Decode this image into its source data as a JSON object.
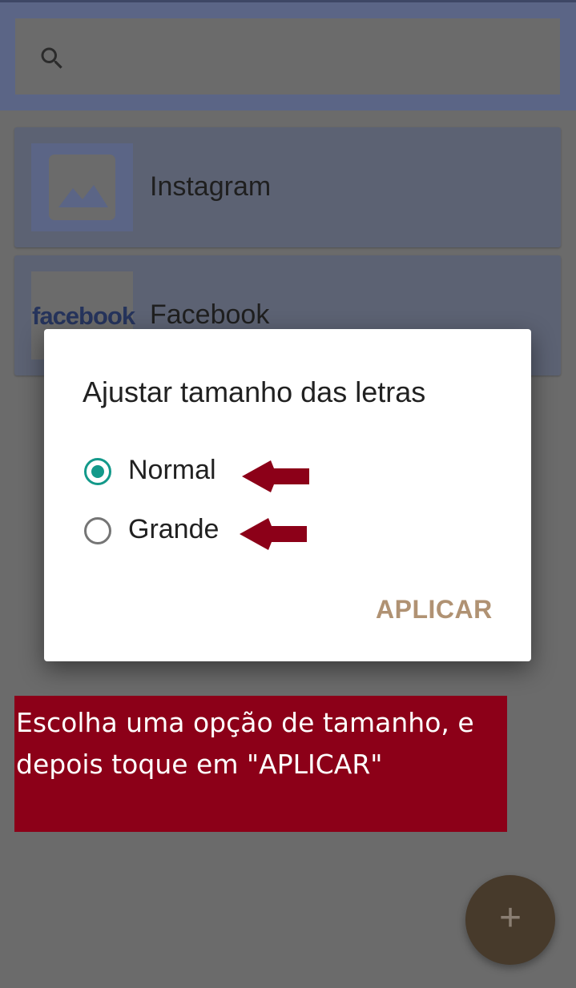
{
  "search": {
    "icon": "search-icon",
    "placeholder": ""
  },
  "apps": [
    {
      "name": "Instagram",
      "thumbnail": "image-placeholder-icon"
    },
    {
      "name": "Facebook",
      "thumbnail": "facebook-logo",
      "logo_text": "facebook"
    }
  ],
  "dialog": {
    "title": "Ajustar tamanho das letras",
    "options": [
      {
        "label": "Normal",
        "selected": true
      },
      {
        "label": "Grande",
        "selected": false
      }
    ],
    "apply_label": "APLICAR"
  },
  "hint": {
    "line1": "Escolha uma opção de tamanho, e",
    "line2": "depois toque em \"APLICAR\""
  },
  "fab": {
    "icon": "plus-icon",
    "symbol": "+"
  },
  "colors": {
    "accent": "#13998a",
    "apply_button": "#b09273",
    "hint_background": "#8c0018",
    "arrow": "#8c0018"
  }
}
